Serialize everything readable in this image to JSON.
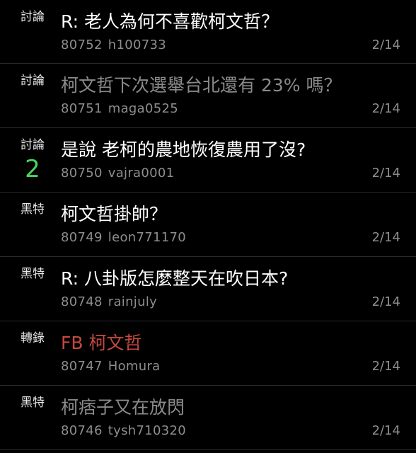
{
  "colors": {
    "background": "#000000",
    "title_normal": "#ffffff",
    "title_read": "#8a8a8a",
    "title_forward": "#c4493f",
    "push_count": "#49d65b",
    "meta": "#8e8e8e"
  },
  "posts": [
    {
      "category": "討論",
      "push": "",
      "title": "R: 老人為何不喜歡柯文哲？",
      "title_color": "#ffffff",
      "id": "80752",
      "author": "h100733",
      "date": "2/14"
    },
    {
      "category": "討論",
      "push": "",
      "title": "柯文哲下次選舉台北還有 23% 嗎？",
      "title_color": "#8a8a8a",
      "id": "80751",
      "author": "maga0525",
      "date": "2/14"
    },
    {
      "category": "討論",
      "push": "2",
      "title": "是說 老柯的農地恢復農用了沒?",
      "title_color": "#ffffff",
      "id": "80750",
      "author": "vajra0001",
      "date": "2/14"
    },
    {
      "category": "黑特",
      "push": "",
      "title": "柯文哲掛帥？",
      "title_color": "#ffffff",
      "id": "80749",
      "author": "leon771170",
      "date": "2/14"
    },
    {
      "category": "黑特",
      "push": "",
      "title": "R: 八卦版怎麼整天在吹日本?",
      "title_color": "#ffffff",
      "id": "80748",
      "author": "rainjuly",
      "date": "2/14"
    },
    {
      "category": "轉錄",
      "push": "",
      "title": "FB 柯文哲",
      "title_color": "#c4493f",
      "id": "80747",
      "author": "Homura",
      "date": "2/14"
    },
    {
      "category": "黑特",
      "push": "",
      "title": "柯痞子又在放閃",
      "title_color": "#8a8a8a",
      "id": "80746",
      "author": "tysh710320",
      "date": "2/14"
    }
  ]
}
